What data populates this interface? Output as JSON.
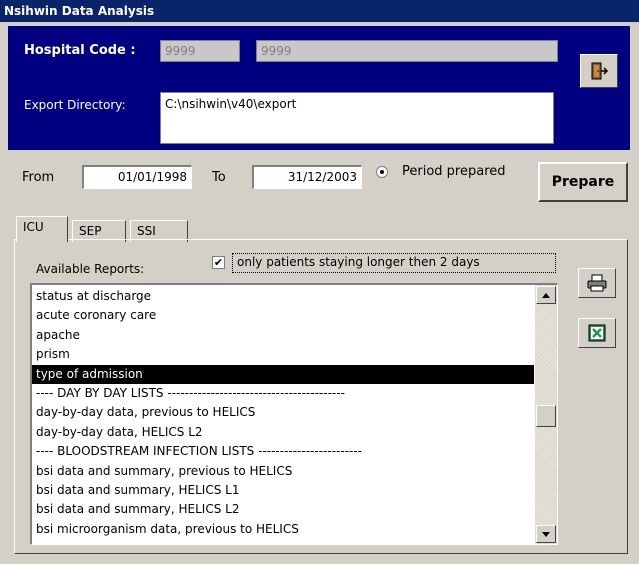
{
  "window": {
    "title": "Nsihwin Data Analysis"
  },
  "header": {
    "hospital_code_label": "Hospital Code :",
    "hospital_code_1": "9999",
    "hospital_code_2": "9999",
    "export_dir_label": "Export Directory:",
    "export_dir_value": "C:\\nsihwin\\v40\\export"
  },
  "period": {
    "from_label": "From",
    "from_value": "01/01/1998",
    "to_label": "To",
    "to_value": "31/12/2003",
    "radio_label": "Period prepared",
    "prepare_label": "Prepare"
  },
  "tabs": [
    {
      "label": "ICU",
      "active": true
    },
    {
      "label": "SEP",
      "active": false
    },
    {
      "label": "SSI",
      "active": false
    }
  ],
  "reports": {
    "label": "Available Reports:",
    "checkbox_mark": "✔",
    "checkbox_label": "only patients staying longer then 2 days",
    "items": [
      "status at discharge",
      "acute coronary care",
      "apache",
      "prism",
      "type of admission",
      "---- DAY BY DAY LISTS -----------------------------------------",
      "day-by-day data, previous to HELICS",
      "day-by-day data, HELICS L2",
      "---- BLOODSTREAM INFECTION LISTS ------------------------",
      "bsi data and summary, previous to HELICS",
      "bsi data and summary, HELICS L1",
      "bsi data and summary, HELICS L2",
      "bsi microorganism data, previous to HELICS"
    ],
    "selected_index": 4
  },
  "icons": {
    "exit": "exit-door-icon",
    "print": "printer-icon",
    "excel": "excel-icon"
  },
  "colors": {
    "title_bar": "#0a246a",
    "panel": "#000080",
    "selection": "#000000"
  }
}
